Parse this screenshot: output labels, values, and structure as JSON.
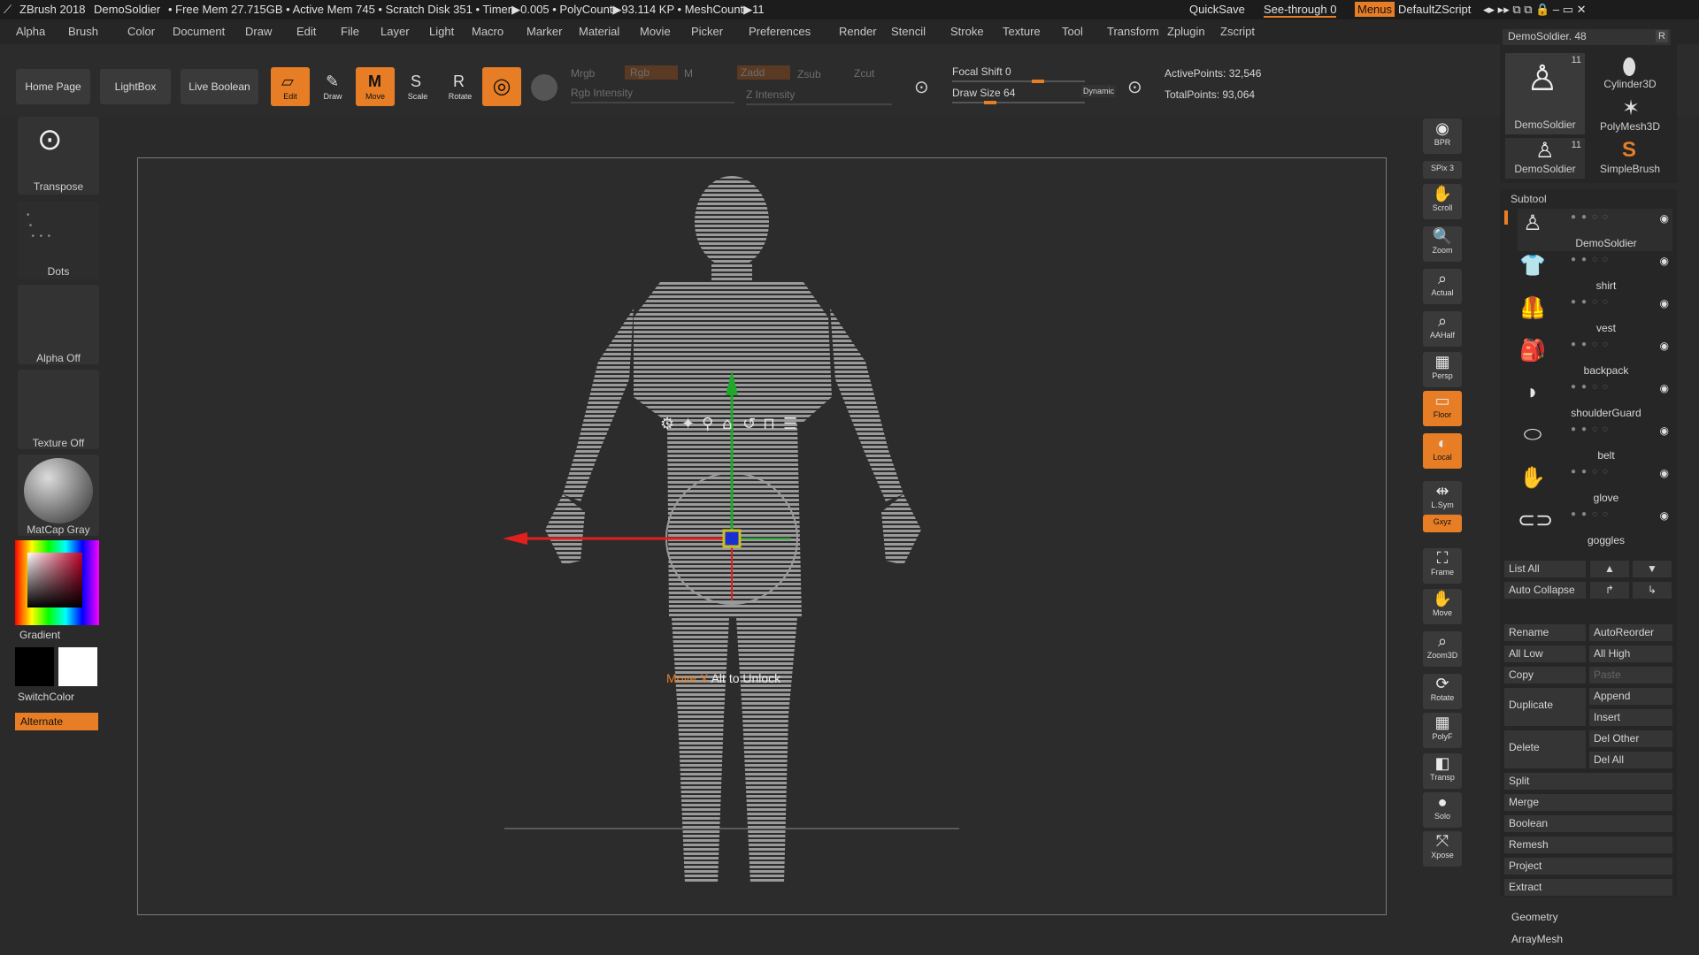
{
  "titlebar": {
    "app": "ZBrush 2018",
    "doc": "DemoSoldier",
    "stats": "• Free Mem 27.715GB • Active Mem 745 • Scratch Disk 351 • Timer▶0.005 • PolyCount▶93.114 KP • MeshCount▶11",
    "quicksave": "QuickSave",
    "seethrough": "See-through",
    "seethrough_val": "0",
    "menus": "Menus",
    "script": "DefaultZScript"
  },
  "menu": [
    "Alpha",
    "Brush",
    "Color",
    "Document",
    "Draw",
    "Edit",
    "File",
    "Layer",
    "Light",
    "Macro",
    "Marker",
    "Material",
    "Movie",
    "Picker",
    "Preferences",
    "Render",
    "Stencil",
    "Stroke",
    "Texture",
    "Tool",
    "Transform",
    "Zplugin",
    "Zscript"
  ],
  "shelf": {
    "home": "Home Page",
    "lightbox": "LightBox",
    "liveboolean": "Live Boolean",
    "edit": "Edit",
    "draw": "Draw",
    "move": "Move",
    "scale": "Scale",
    "rotate": "Rotate",
    "mrgb": "Mrgb",
    "rgb": "Rgb",
    "m": "M",
    "zadd": "Zadd",
    "zsub": "Zsub",
    "zcut": "Zcut",
    "rgb_intensity": "Rgb Intensity",
    "z_intensity": "Z Intensity",
    "focal": "Focal Shift 0",
    "drawsize": "Draw Size 64",
    "dynamic": "Dynamic",
    "active": "ActivePoints: 32,546",
    "total": "TotalPoints: 93,064"
  },
  "left": {
    "transpose": "Transpose",
    "dots": "Dots",
    "alpha": "Alpha Off",
    "texture": "Texture Off",
    "matcap": "MatCap Gray",
    "gradient": "Gradient",
    "switchcolor": "SwitchColor",
    "alternate": "Alternate"
  },
  "viewport": {
    "hint_axis": "Move X",
    "hint_rest": "Alt to Unlock",
    "colors": {
      "x": "#e0201c",
      "y": "#1fa82a",
      "z": "#1a2fd0"
    }
  },
  "rightstrip": [
    {
      "label": "BPR",
      "icon": "◉"
    },
    {
      "label": "SPix 3",
      "icon": ""
    },
    {
      "label": "Scroll",
      "icon": "✋"
    },
    {
      "label": "Zoom",
      "icon": "🔍"
    },
    {
      "label": "Actual",
      "icon": "⌕"
    },
    {
      "label": "AAHalf",
      "icon": "⌕"
    },
    {
      "label": "Persp",
      "icon": "▦"
    },
    {
      "label": "Floor",
      "icon": "▭"
    },
    {
      "label": "Local",
      "icon": "◐"
    },
    {
      "label": "L.Sym",
      "icon": "⇹"
    },
    {
      "label": "Gxyz",
      "icon": ""
    },
    {
      "label": "Frame",
      "icon": "⛶"
    },
    {
      "label": "Move",
      "icon": "✋"
    },
    {
      "label": "Zoom3D",
      "icon": "⌕"
    },
    {
      "label": "Rotate",
      "icon": "⟳"
    },
    {
      "label": "PolyF",
      "icon": "▦"
    },
    {
      "label": "Transp",
      "icon": "◧"
    },
    {
      "label": "Solo",
      "icon": "●"
    },
    {
      "label": "Xpose",
      "icon": "⤧"
    }
  ],
  "tool": {
    "current": "DemoSoldier. 48",
    "r": "R",
    "items": [
      {
        "name": "DemoSoldier",
        "count": "11"
      },
      {
        "name": "Cylinder3D",
        "count": ""
      },
      {
        "name": "PolyMesh3D",
        "count": ""
      },
      {
        "name": "DemoSoldier",
        "count": "11"
      },
      {
        "name": "SimpleBrush",
        "count": ""
      }
    ]
  },
  "subtool": {
    "title": "Subtool",
    "items": [
      "DemoSoldier",
      "shirt",
      "vest",
      "backpack",
      "shoulderGuard",
      "belt",
      "glove",
      "goggles"
    ],
    "listall": "List All",
    "autocollapse": "Auto Collapse",
    "rename": "Rename",
    "autoreorder": "AutoReorder",
    "alllow": "All Low",
    "allhigh": "All High",
    "copy": "Copy",
    "paste": "Paste",
    "duplicate": "Duplicate",
    "append": "Append",
    "insert": "Insert",
    "delete": "Delete",
    "delother": "Del Other",
    "delall": "Del All",
    "split": "Split",
    "merge": "Merge",
    "boolean": "Boolean",
    "remesh": "Remesh",
    "project": "Project",
    "extract": "Extract",
    "geometry": "Geometry",
    "arraymesh": "ArrayMesh"
  },
  "accent": "#e77e26"
}
